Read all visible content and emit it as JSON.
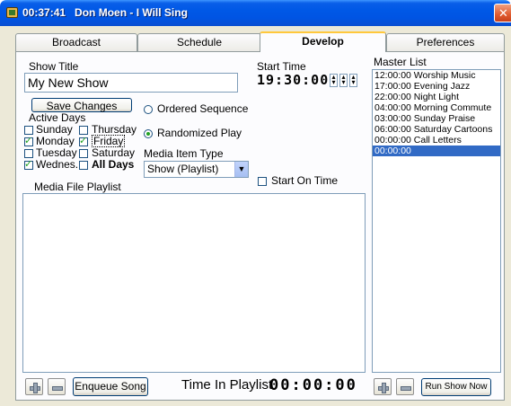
{
  "window": {
    "title": "00:37:41   Don Moen - I Will Sing",
    "close_glyph": "✕"
  },
  "tabs": [
    {
      "label": "Broadcast",
      "active": false
    },
    {
      "label": "Schedule",
      "active": false
    },
    {
      "label": "Develop",
      "active": true
    },
    {
      "label": "Preferences",
      "active": false
    }
  ],
  "develop": {
    "show_title_label": "Show Title",
    "show_title_value": "My New Show",
    "save_changes_label": "Save Changes",
    "active_days_label": "Active Days",
    "days": [
      {
        "label": "Sunday",
        "checked": false
      },
      {
        "label": "Thursday",
        "checked": false
      },
      {
        "label": "Monday",
        "checked": true
      },
      {
        "label": "Friday",
        "checked": true
      },
      {
        "label": "Tuesday",
        "checked": false
      },
      {
        "label": "Saturday",
        "checked": false
      },
      {
        "label": "Wednes.",
        "checked": true
      },
      {
        "label": "All Days",
        "checked": false
      }
    ],
    "start_time_label": "Start Time",
    "start_time_value": "19:30:00",
    "ordered_sequence_label": "Ordered Sequence",
    "randomized_play_label": "Randomized Play",
    "play_mode": "randomized",
    "media_item_type_label": "Media Item Type",
    "media_item_type_value": "Show (Playlist)",
    "start_on_time_label": "Start On Time",
    "start_on_time_checked": false,
    "media_file_playlist_label": "Media File Playlist",
    "enqueue_song_label": "Enqueue Song",
    "time_in_playlist_label": "Time In Playlist",
    "time_in_playlist_value": "00:00:00"
  },
  "master_list": {
    "label": "Master List",
    "items": [
      {
        "text": "12:00:00 Worship Music",
        "selected": false
      },
      {
        "text": "17:00:00 Evening Jazz",
        "selected": false
      },
      {
        "text": "22:00:00 Night Light",
        "selected": false
      },
      {
        "text": "04:00:00 Morning Commute",
        "selected": false
      },
      {
        "text": "03:00:00 Sunday Praise",
        "selected": false
      },
      {
        "text": "06:00:00 Saturday Cartoons",
        "selected": false
      },
      {
        "text": "00:00:00 Call Letters",
        "selected": false
      },
      {
        "text": "00:00:00",
        "selected": true
      }
    ],
    "run_show_now_label": "Run Show Now"
  },
  "colors": {
    "titlebar": "#0054e3",
    "selection": "#316ac5",
    "check": "#21a121",
    "tab_highlight": "#ffc83c"
  }
}
